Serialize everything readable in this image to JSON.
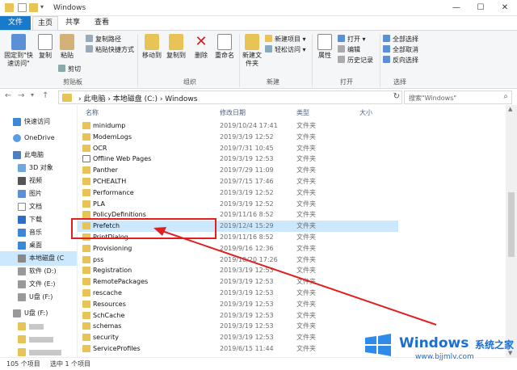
{
  "window": {
    "title": "Windows",
    "minimize": "—",
    "maximize": "☐",
    "close": "✕"
  },
  "tabs": {
    "file": "文件",
    "home": "主页",
    "share": "共享",
    "view": "查看"
  },
  "ribbon": {
    "pin_quick": "固定到\"快速访问\"",
    "copy": "复制",
    "paste": "粘贴",
    "copy_path": "复制路径",
    "paste_shortcut": "粘贴快捷方式",
    "cut": "剪切",
    "clipboard_group": "剪贴板",
    "move_to": "移动到",
    "copy_to": "复制到",
    "delete": "删除",
    "rename": "重命名",
    "organize_group": "组织",
    "new_folder": "新建文件夹",
    "new_item": "新建项目 ▾",
    "easy_access": "轻松访问 ▾",
    "new_group": "新建",
    "properties": "属性",
    "open": "打开 ▾",
    "edit": "编辑",
    "history": "历史记录",
    "open_group": "打开",
    "select_all": "全部选择",
    "select_none": "全部取消",
    "invert_selection": "反向选择",
    "select_group": "选择"
  },
  "address": {
    "path": "› 此电脑 › 本地磁盘 (C:) › Windows",
    "search_placeholder": "搜索\"Windows\""
  },
  "navpane": {
    "quick_access": "快速访问",
    "onedrive": "OneDrive",
    "this_pc": "此电脑",
    "objects3d": "3D 对象",
    "videos": "视频",
    "pictures": "图片",
    "documents": "文档",
    "downloads": "下载",
    "music": "音乐",
    "desktop": "桌面",
    "local_disk": "本地磁盘 (C",
    "software": "软件 (D:)",
    "files": "文件 (E:)",
    "udisk": "U盘 (F:)",
    "udisk2": "U盘 (F:)"
  },
  "columns": {
    "name": "名称",
    "date": "修改日期",
    "type": "类型",
    "size": "大小"
  },
  "files": [
    {
      "name": "minidump",
      "date": "2019/10/24 17:41",
      "type": "文件夹"
    },
    {
      "name": "ModemLogs",
      "date": "2019/3/19 12:52",
      "type": "文件夹"
    },
    {
      "name": "OCR",
      "date": "2019/7/31 10:45",
      "type": "文件夹"
    },
    {
      "name": "Offline Web Pages",
      "date": "2019/3/19 12:53",
      "type": "文件夹"
    },
    {
      "name": "Panther",
      "date": "2019/7/29 11:09",
      "type": "文件夹"
    },
    {
      "name": "PCHEALTH",
      "date": "2019/7/15 17:46",
      "type": "文件夹"
    },
    {
      "name": "Performance",
      "date": "2019/3/19 12:52",
      "type": "文件夹"
    },
    {
      "name": "PLA",
      "date": "2019/3/19 12:52",
      "type": "文件夹"
    },
    {
      "name": "PolicyDefinitions",
      "date": "2019/11/16 8:52",
      "type": "文件夹"
    },
    {
      "name": "Prefetch",
      "date": "2019/12/4 15:29",
      "type": "文件夹"
    },
    {
      "name": "PrintDialog",
      "date": "2019/11/16 8:52",
      "type": "文件夹"
    },
    {
      "name": "Provisioning",
      "date": "2019/9/16 12:36",
      "type": "文件夹"
    },
    {
      "name": "pss",
      "date": "2019/10/20 17:26",
      "type": "文件夹"
    },
    {
      "name": "Registration",
      "date": "2019/3/19 12:53",
      "type": "文件夹"
    },
    {
      "name": "RemotePackages",
      "date": "2019/3/19 12:53",
      "type": "文件夹"
    },
    {
      "name": "rescache",
      "date": "2019/3/19 12:53",
      "type": "文件夹"
    },
    {
      "name": "Resources",
      "date": "2019/3/19 12:53",
      "type": "文件夹"
    },
    {
      "name": "SchCache",
      "date": "2019/3/19 12:53",
      "type": "文件夹"
    },
    {
      "name": "schemas",
      "date": "2019/3/19 12:53",
      "type": "文件夹"
    },
    {
      "name": "security",
      "date": "2019/3/19 12:53",
      "type": "文件夹"
    },
    {
      "name": "ServiceProfiles",
      "date": "2019/6/15 11:44",
      "type": "文件夹"
    }
  ],
  "selected_index": 9,
  "status": {
    "count": "105 个项目",
    "selected": "选中 1 个项目"
  },
  "watermark": {
    "brand": "Windows",
    "cn": "系统之家",
    "url": "www.bjjmlv.com"
  },
  "colors": {
    "accent": "#1979ca",
    "selection": "#cce8ff",
    "annotation": "#e02020",
    "folder": "#e7c455"
  }
}
